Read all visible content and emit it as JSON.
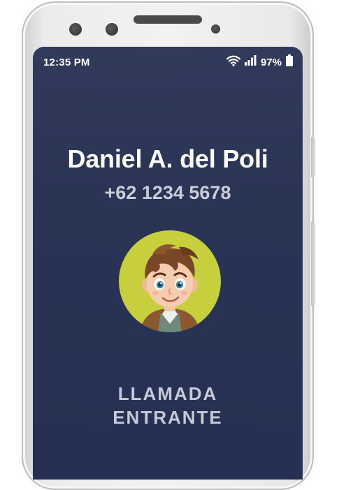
{
  "status_bar": {
    "time": "12:35 PM",
    "battery_percent": "97%",
    "icons": [
      "wifi-icon",
      "signal-icon",
      "battery-icon"
    ]
  },
  "caller": {
    "name": "Daniel A. del Poli",
    "number": "+62 1234 5678",
    "avatar": "cartoon-boy-avatar"
  },
  "call_status": {
    "line1": "LLAMADA",
    "line2": "ENTRANTE"
  },
  "colors": {
    "screen_bg": "#293354",
    "avatar_bg": "#c8cf3d",
    "text_primary": "#ffffff",
    "text_secondary": "#c9cdd8"
  }
}
